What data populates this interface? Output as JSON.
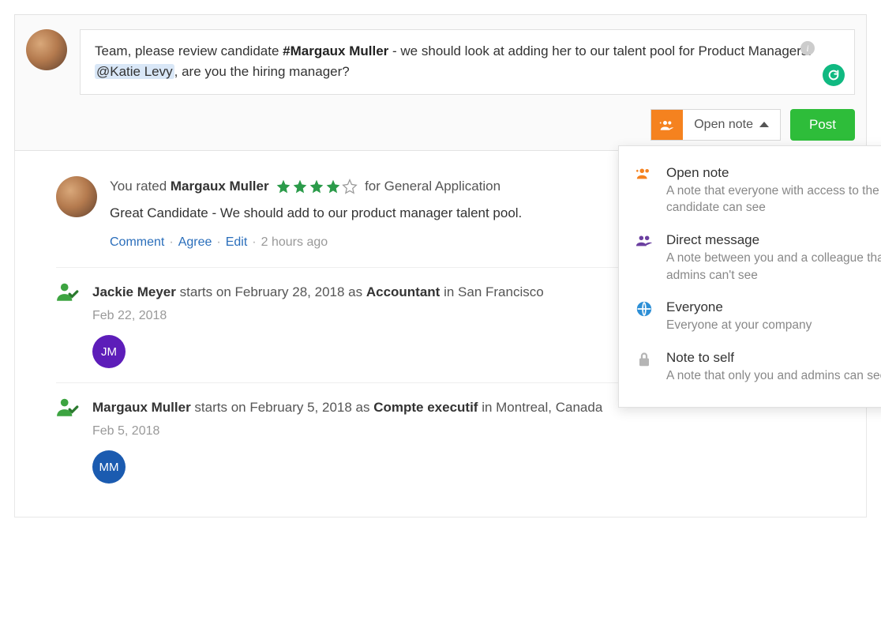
{
  "compose": {
    "text_pre": "Team, please review candidate ",
    "candidate_tag": "#Margaux Muller",
    "text_mid": " - we should look at adding her to our talent pool for Product Managers. ",
    "mention": "@Katie Levy",
    "text_post": ", are you the hiring manager?"
  },
  "actions": {
    "note_type_label": "Open note",
    "post_label": "Post"
  },
  "dropdown": [
    {
      "icon": "group-plus",
      "color": "#f5821f",
      "title": "Open note",
      "desc": "A note that everyone with access to the candidate can see"
    },
    {
      "icon": "group",
      "color": "#6b3fa0",
      "title": "Direct message",
      "desc": "A note between you and a colleague that admins can't see"
    },
    {
      "icon": "globe",
      "color": "#2d8fd6",
      "title": "Everyone",
      "desc": "Everyone at your company"
    },
    {
      "icon": "lock",
      "color": "#b5b5b5",
      "title": "Note to self",
      "desc": "A note that only you and admins can see"
    }
  ],
  "feed": {
    "review": {
      "prefix": "You rated ",
      "name": "Margaux Muller",
      "stars": 4,
      "max_stars": 5,
      "suffix": " for General Application",
      "body": "Great Candidate - We should add to our product manager talent pool.",
      "links": {
        "comment": "Comment",
        "agree": "Agree",
        "edit": "Edit"
      },
      "ago": "2 hours ago"
    },
    "events": [
      {
        "name": "Jackie Meyer",
        "mid1": " starts on February 28, 2018 as ",
        "role": "Accountant",
        "mid2": " in San Francisco",
        "date": "Feb 22, 2018",
        "initials": "JM",
        "initials_bg": "#5d1db9"
      },
      {
        "name": "Margaux Muller",
        "mid1": " starts on February 5, 2018 as ",
        "role": "Compte executif",
        "mid2": " in Montreal, Canada",
        "date": "Feb 5, 2018",
        "initials": "MM",
        "initials_bg": "#1b5bb0"
      }
    ]
  }
}
